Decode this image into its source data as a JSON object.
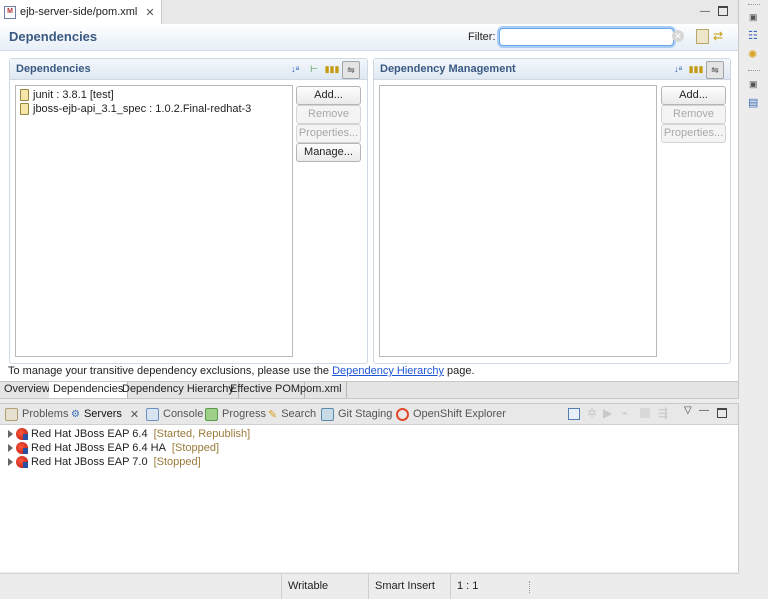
{
  "editor_tab": {
    "label": "ejb-server-side/pom.xml",
    "close": "✕"
  },
  "form": {
    "title": "Dependencies",
    "filter_label": "Filter:",
    "filter_value": ""
  },
  "dependencies_section": {
    "title": "Dependencies",
    "items": [
      {
        "label": "junit : 3.8.1 [test]"
      },
      {
        "label": "jboss-ejb-api_3.1_spec : 1.0.2.Final-redhat-3"
      }
    ],
    "buttons": {
      "add": "Add...",
      "remove": "Remove",
      "properties": "Properties...",
      "manage": "Manage..."
    }
  },
  "management_section": {
    "title": "Dependency Management",
    "buttons": {
      "add": "Add...",
      "remove": "Remove",
      "properties": "Properties..."
    }
  },
  "note": {
    "prefix": "To manage your transitive dependency exclusions, please use the ",
    "link": "Dependency Hierarchy",
    "suffix": " page."
  },
  "page_tabs": [
    "Overview",
    "Dependencies",
    "Dependency Hierarchy",
    "Effective POM",
    "pom.xml"
  ],
  "view_tabs": [
    "Problems",
    "Servers",
    "Console",
    "Progress",
    "Search",
    "Git Staging",
    "OpenShift Explorer"
  ],
  "servers": [
    {
      "name": "Red Hat JBoss EAP 6.4",
      "status": "[Started, Republish]"
    },
    {
      "name": "Red Hat JBoss EAP 6.4 HA",
      "status": "[Stopped]"
    },
    {
      "name": "Red Hat JBoss EAP 7.0",
      "status": "[Stopped]"
    }
  ],
  "statusbar": {
    "writable": "Writable",
    "insert_mode": "Smart Insert",
    "position": "1 : 1"
  },
  "colors": {
    "accent": "#3a5a82",
    "link": "#1e56d6",
    "status": "#9a7a3a"
  }
}
